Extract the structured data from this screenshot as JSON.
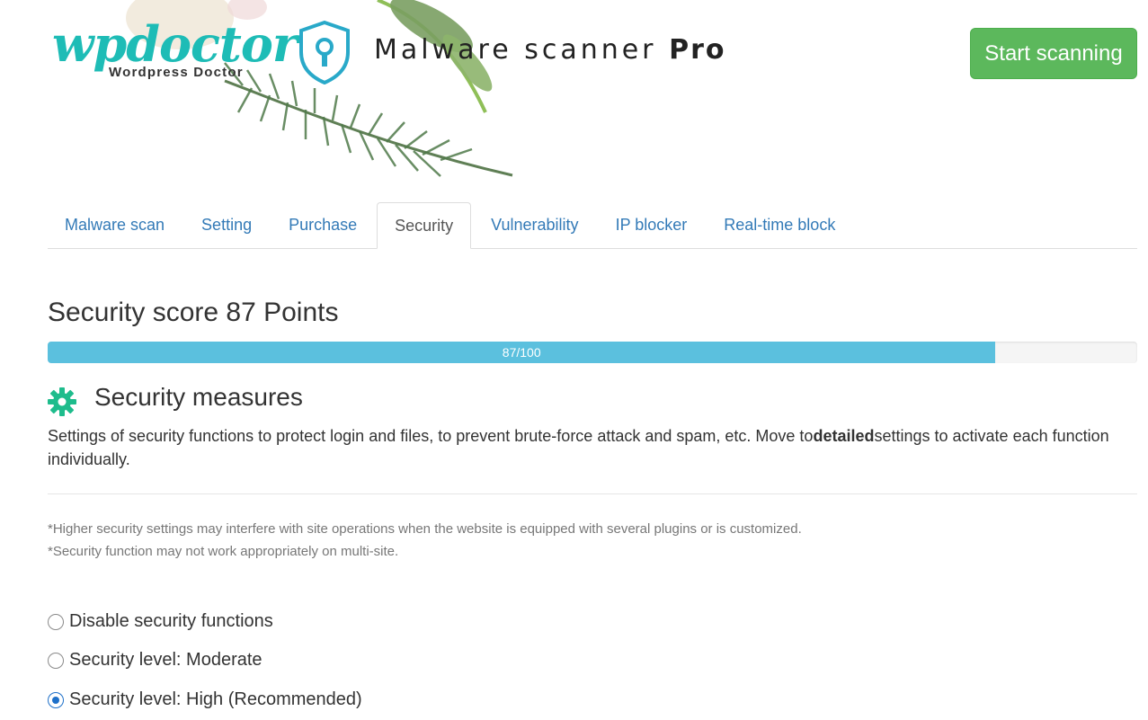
{
  "header": {
    "logo_main": "wpdoctor",
    "logo_sub": "Wordpress Doctor",
    "product_name": "Malware scanner",
    "product_edition": "Pro",
    "start_button": "Start scanning",
    "accent_color": "#1ebcb6",
    "button_color": "#5cb85c"
  },
  "tabs": [
    {
      "label": "Malware scan",
      "active": false
    },
    {
      "label": "Setting",
      "active": false
    },
    {
      "label": "Purchase",
      "active": false
    },
    {
      "label": "Security",
      "active": true
    },
    {
      "label": "Vulnerability",
      "active": false
    },
    {
      "label": "IP blocker",
      "active": false
    },
    {
      "label": "Real-time block",
      "active": false
    }
  ],
  "score": {
    "title": "Security score 87 Points",
    "progress_label": "87/100",
    "value": 87,
    "max": 100,
    "bar_color": "#5bc0de"
  },
  "measures": {
    "icon": "gear-icon",
    "title": "Security measures",
    "desc_before": "Settings of security functions to protect login and files, to prevent brute-force attack and spam, etc. Move to",
    "desc_bold": "detailed",
    "desc_after": "settings to activate each function individually."
  },
  "notes": [
    "*Higher security settings may interfere with site operations when the website is equipped with several plugins or is customized.",
    "*Security function may not work appropriately on multi-site."
  ],
  "levels": [
    {
      "label": "Disable security functions",
      "checked": false
    },
    {
      "label": "Security level: Moderate",
      "checked": false
    },
    {
      "label": "Security level: High (Recommended)",
      "checked": true
    }
  ]
}
